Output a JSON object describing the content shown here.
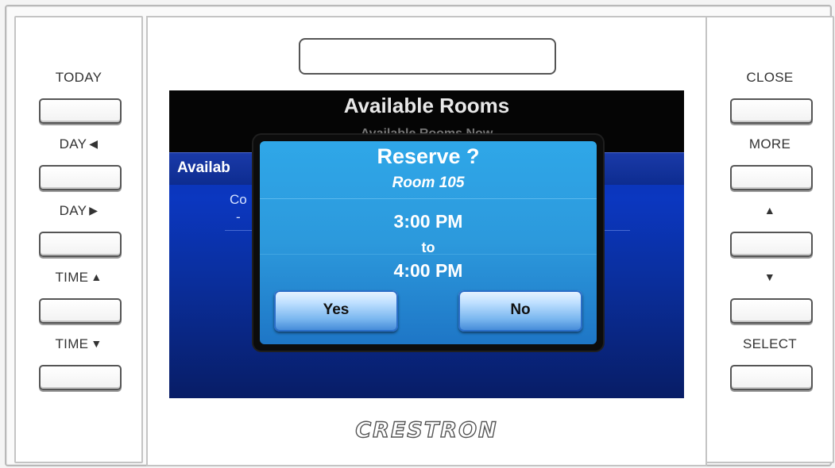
{
  "left_buttons": [
    {
      "label": "TODAY",
      "arrow": ""
    },
    {
      "label": "DAY",
      "arrow": "◀"
    },
    {
      "label": "DAY",
      "arrow": "▶"
    },
    {
      "label": "TIME",
      "arrow": "▲"
    },
    {
      "label": "TIME",
      "arrow": "▼"
    }
  ],
  "right_buttons": [
    {
      "label": "CLOSE",
      "arrow": ""
    },
    {
      "label": "MORE",
      "arrow": ""
    },
    {
      "label": "",
      "arrow": "▲"
    },
    {
      "label": "",
      "arrow": "▼"
    },
    {
      "label": "SELECT",
      "arrow": ""
    }
  ],
  "screen": {
    "title": "Available Rooms",
    "subtitle": "Available Rooms Now",
    "list_header": "Availab",
    "bg_line1": "Co",
    "bg_line2": "-"
  },
  "dialog": {
    "title": "Reserve ?",
    "room": "Room 105",
    "start_time": "3:00 PM",
    "separator": "to",
    "end_time": "4:00 PM",
    "yes_label": "Yes",
    "no_label": "No"
  },
  "brand": "CRESTRON",
  "colors": {
    "screen_blue": "#0b37c0",
    "dialog_blue": "#2c99dc",
    "header_black": "#050505"
  }
}
